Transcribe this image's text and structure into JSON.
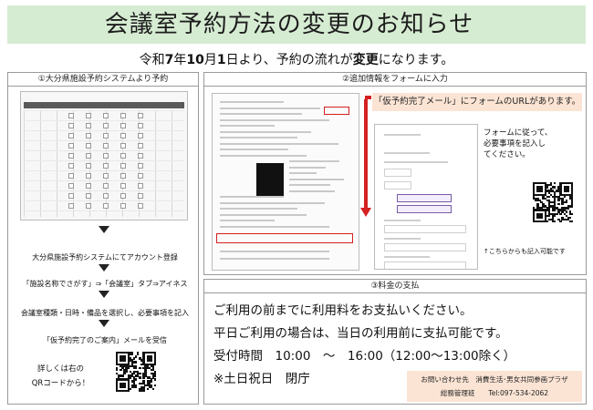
{
  "title": "会議室予約方法の変更のお知らせ",
  "subtitle": {
    "prefix": "令和",
    "year": "7",
    "year_unit": "年",
    "month": "10",
    "month_unit": "月",
    "day": "1",
    "day_unit": "日",
    "middle": "より、予約の流れが",
    "highlight": "変更",
    "suffix": "になります。"
  },
  "section1": {
    "heading": "①大分県施設予約システムより予約",
    "step1": "大分県施設予約システムにてアカウント登録",
    "step2": "「施設名称でさがす」⇒「会議室」タブ⇒アイネス",
    "step3": "会議室種類・日時・備品を選択し、必要事項を記入",
    "step4": "「仮予約完了のご案内」メールを受信",
    "qr_note_1": "詳しくは右の",
    "qr_note_2": "QRコードから！"
  },
  "section2": {
    "heading": "②追加情報をフォームに入力",
    "callout": "「仮予約完了メール」にフォームのURLがあります。",
    "note_1": "フォームに従って、",
    "note_2": "必要事項を記入し",
    "note_3": "てください。",
    "qr_note": "↑こちらからも記入可能です"
  },
  "section3": {
    "heading": "③料金の支払",
    "line1": "ご利用の前までに利用料をお支払いください。",
    "line2": "平日ご利用の場合は、当日の利用前に支払可能です。",
    "line3": "受付時間　10:00　～　16:00（12:00～13:00除く）",
    "line4": "※土日祝日　閉庁",
    "contact_line1": "お問い合わせ先　消費生活･男女共同参画プラザ",
    "contact_line2": "総務管理班　　Tel:097-534-2062"
  },
  "colors": {
    "banner": "#d6ecd2",
    "callout": "#fbe4d4",
    "accent_red": "#d42020"
  }
}
